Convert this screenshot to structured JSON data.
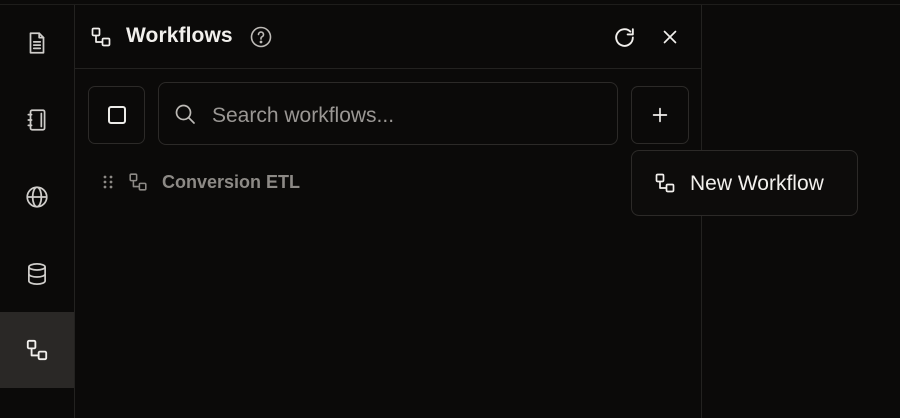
{
  "sidebar": {
    "items": [
      {
        "icon": "document-icon"
      },
      {
        "icon": "notebook-icon"
      },
      {
        "icon": "globe-icon"
      },
      {
        "icon": "database-icon"
      },
      {
        "icon": "workflow-icon",
        "active": true
      }
    ]
  },
  "panel": {
    "title": "Workflows",
    "search": {
      "placeholder": "Search workflows...",
      "value": ""
    },
    "items": [
      {
        "label": "Conversion ETL",
        "icon": "workflow-icon"
      }
    ]
  },
  "menu": {
    "items": [
      {
        "label": "New Workflow",
        "icon": "workflow-icon"
      }
    ]
  },
  "colors": {
    "background": "#0b0a09",
    "active_rail": "#2a2826",
    "border": "#2c2a28",
    "text": "#f2f0ed",
    "muted_text": "#8d8a86"
  }
}
